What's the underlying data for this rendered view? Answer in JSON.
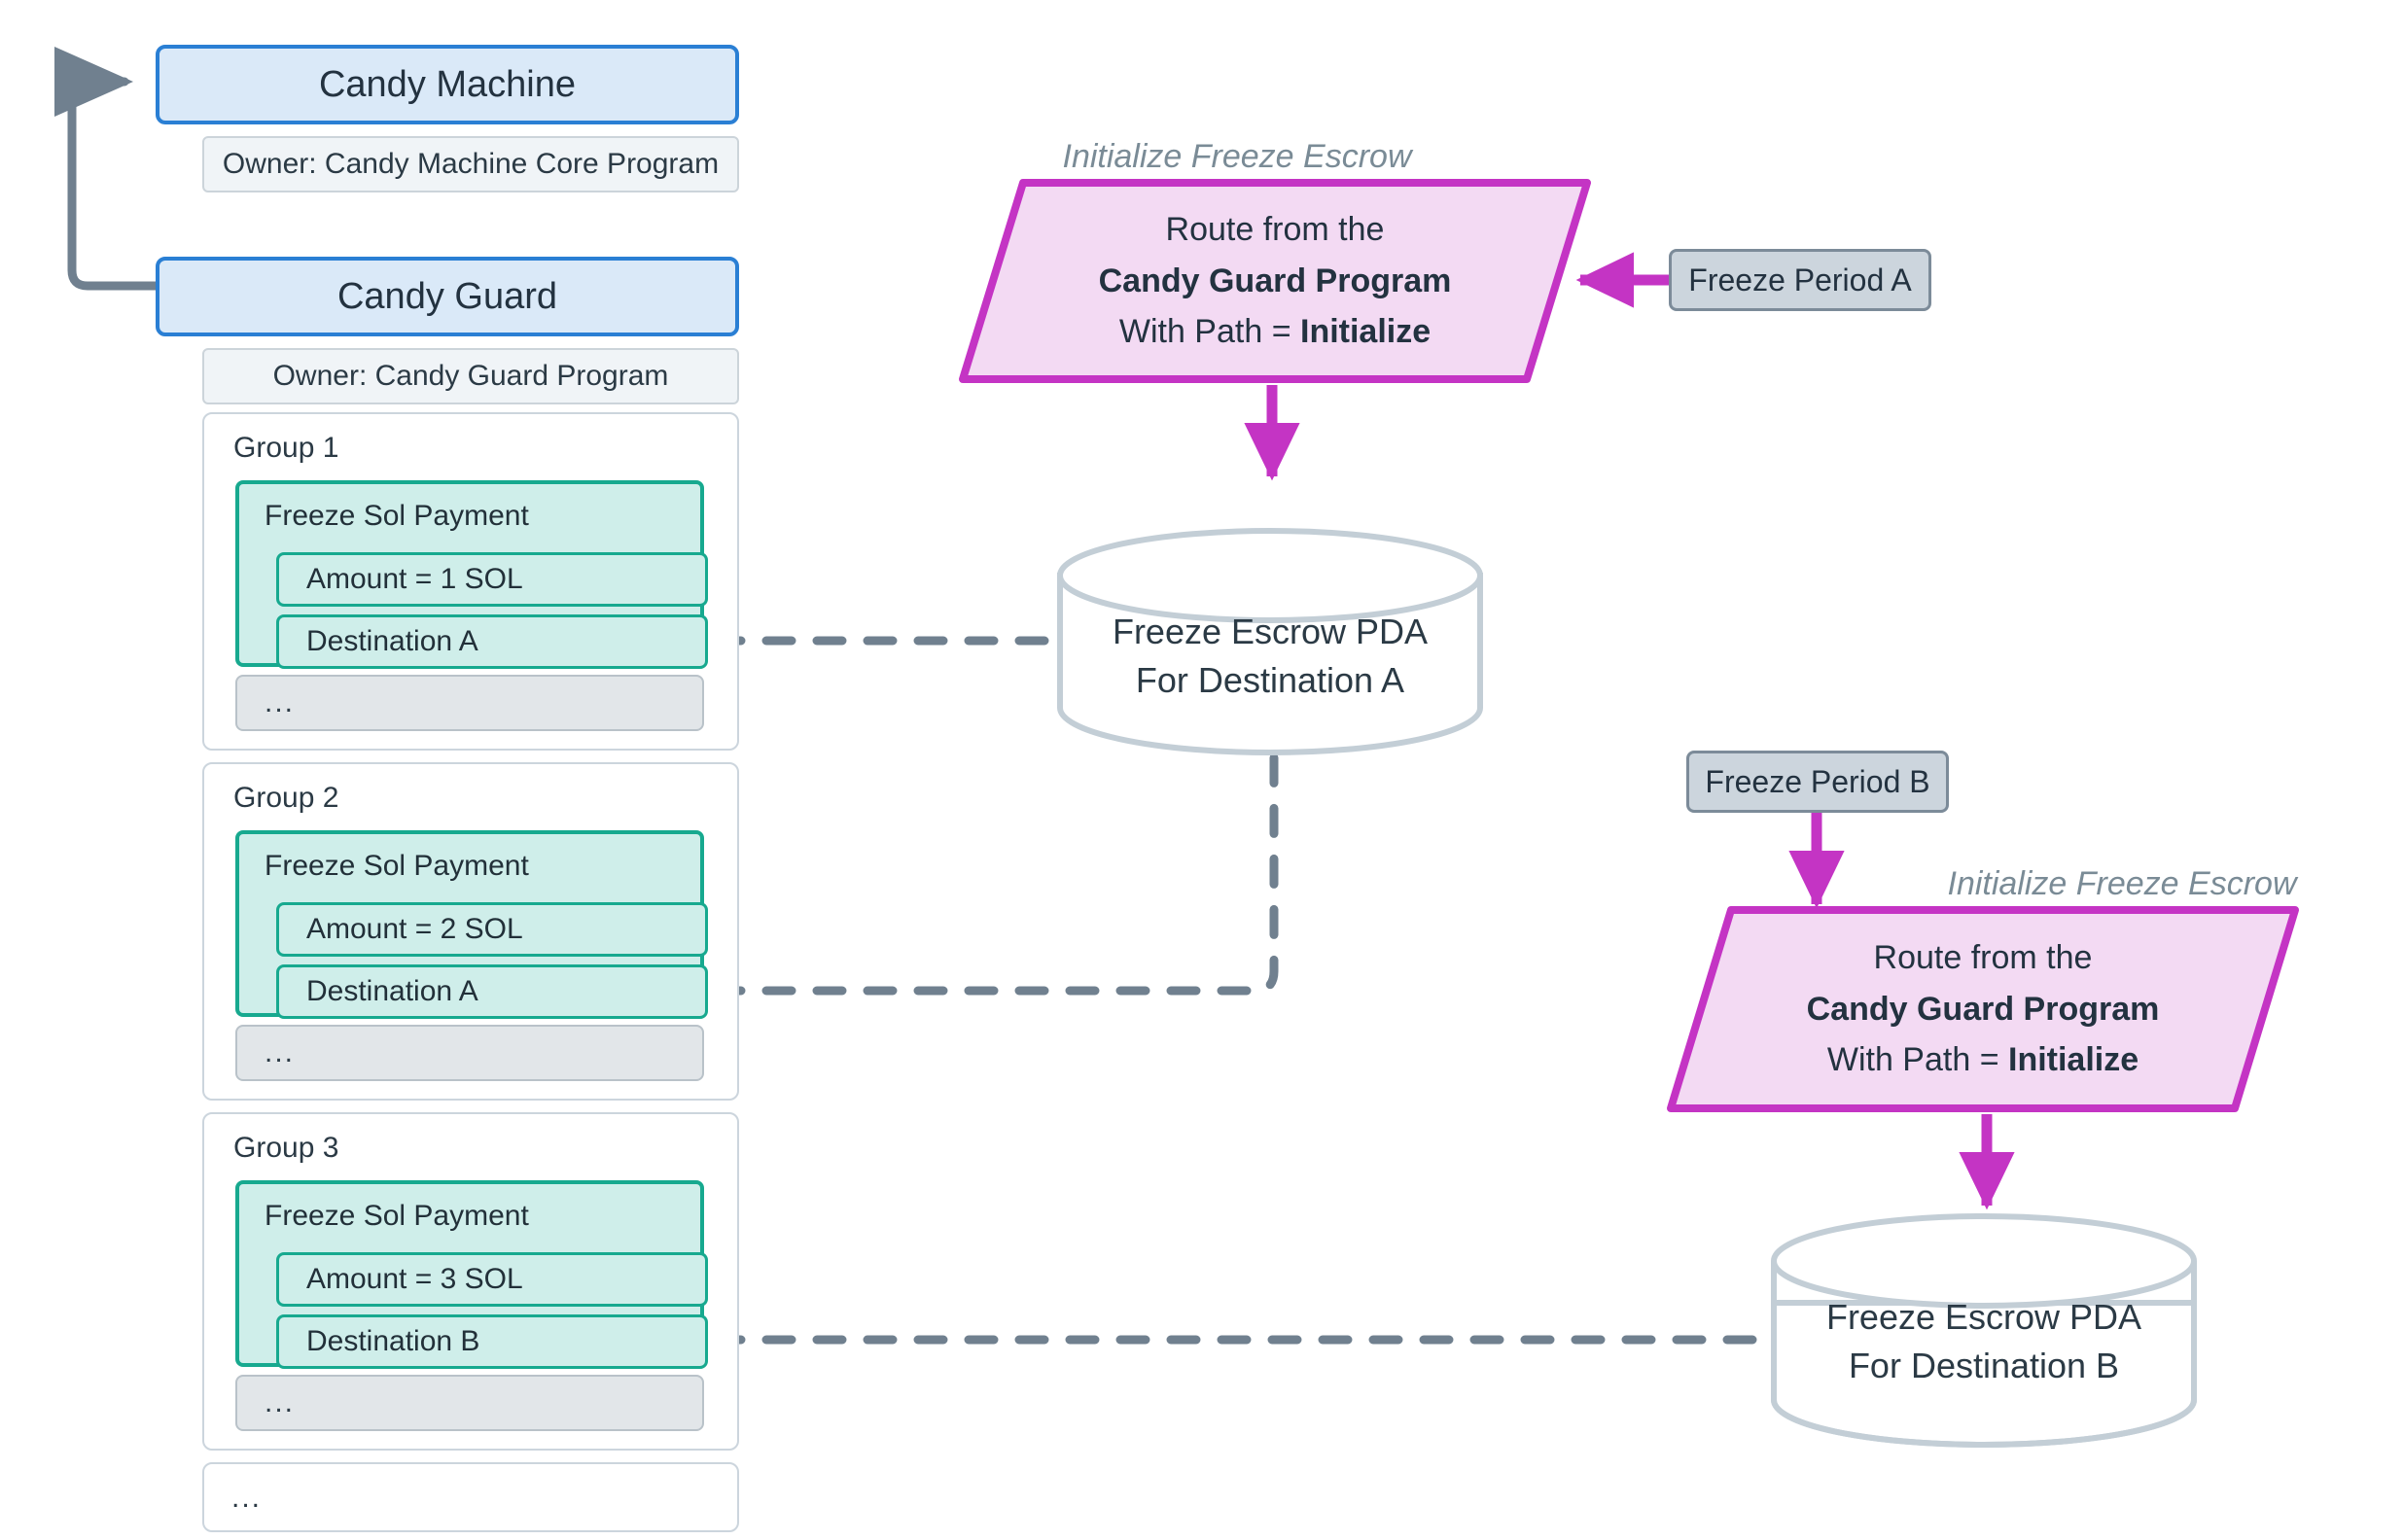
{
  "colors": {
    "blue_border": "#2a7fd4",
    "blue_fill": "#dae9f8",
    "teal_border": "#17a98f",
    "teal_fill": "#cfeeea",
    "magenta": "#c434c4",
    "magenta_fill": "#f3daf3",
    "grey_pill": "#ccd5dd",
    "line_grey": "#70808f",
    "cyl_stroke": "#c3ced6"
  },
  "candy_machine": {
    "title": "Candy Machine",
    "owner": "Owner: Candy Machine Core Program"
  },
  "candy_guard": {
    "title": "Candy Guard",
    "owner": "Owner: Candy Guard Program",
    "trailing_ellipsis": "...",
    "groups": [
      {
        "title": "Group 1",
        "guard_name": "Freeze Sol Payment",
        "amount": "Amount = 1 SOL",
        "destination": "Destination A",
        "ellipsis": "..."
      },
      {
        "title": "Group 2",
        "guard_name": "Freeze Sol Payment",
        "amount": "Amount = 2 SOL",
        "destination": "Destination A",
        "ellipsis": "..."
      },
      {
        "title": "Group 3",
        "guard_name": "Freeze Sol Payment",
        "amount": "Amount = 3 SOL",
        "destination": "Destination B",
        "ellipsis": "..."
      }
    ]
  },
  "route_a": {
    "caption": "Initialize Freeze Escrow",
    "line1": "Route from the",
    "line2": "Candy Guard Program",
    "line3_prefix": "With Path = ",
    "line3_bold": "Initialize"
  },
  "route_b": {
    "caption": "Initialize Freeze Escrow",
    "line1": "Route from the",
    "line2": "Candy Guard Program",
    "line3_prefix": "With Path = ",
    "line3_bold": "Initialize"
  },
  "freeze_period_a": {
    "label": "Freeze Period A"
  },
  "freeze_period_b": {
    "label": "Freeze Period B"
  },
  "escrow_a": {
    "line1": "Freeze Escrow PDA",
    "line2": "For Destination A"
  },
  "escrow_b": {
    "line1": "Freeze Escrow PDA",
    "line2": "For Destination B"
  }
}
